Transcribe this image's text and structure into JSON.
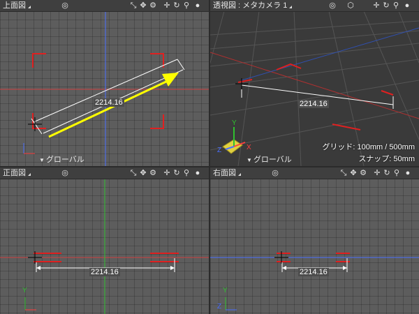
{
  "viewports": {
    "top": {
      "title": "上面図",
      "mode": "グローバル",
      "dimension": "2214.16"
    },
    "persp": {
      "title": "透視図 : メタカメラ 1",
      "mode": "グローバル",
      "dimension": "2214.16",
      "grid_label": "グリッド: 100mm / 500mm",
      "snap_label": "スナップ: 50mm"
    },
    "front": {
      "title": "正面図",
      "dimension": "2214.16"
    },
    "right": {
      "title": "右面図",
      "dimension": "2214.16"
    }
  },
  "axes": {
    "x": "X",
    "y": "Y",
    "z": "Z"
  },
  "icons": [
    "target-icon",
    "cube-icon",
    "resize-icon",
    "pan-icon",
    "rotate-icon",
    "gear-icon",
    "move-icon",
    "zoom-icon",
    "shading-icon"
  ],
  "colors": {
    "axis_red": "#ff4040",
    "axis_green": "#2fc02f",
    "axis_blue": "#4a6fff",
    "arrow": "#ffff00",
    "bracket": "#e02020"
  }
}
